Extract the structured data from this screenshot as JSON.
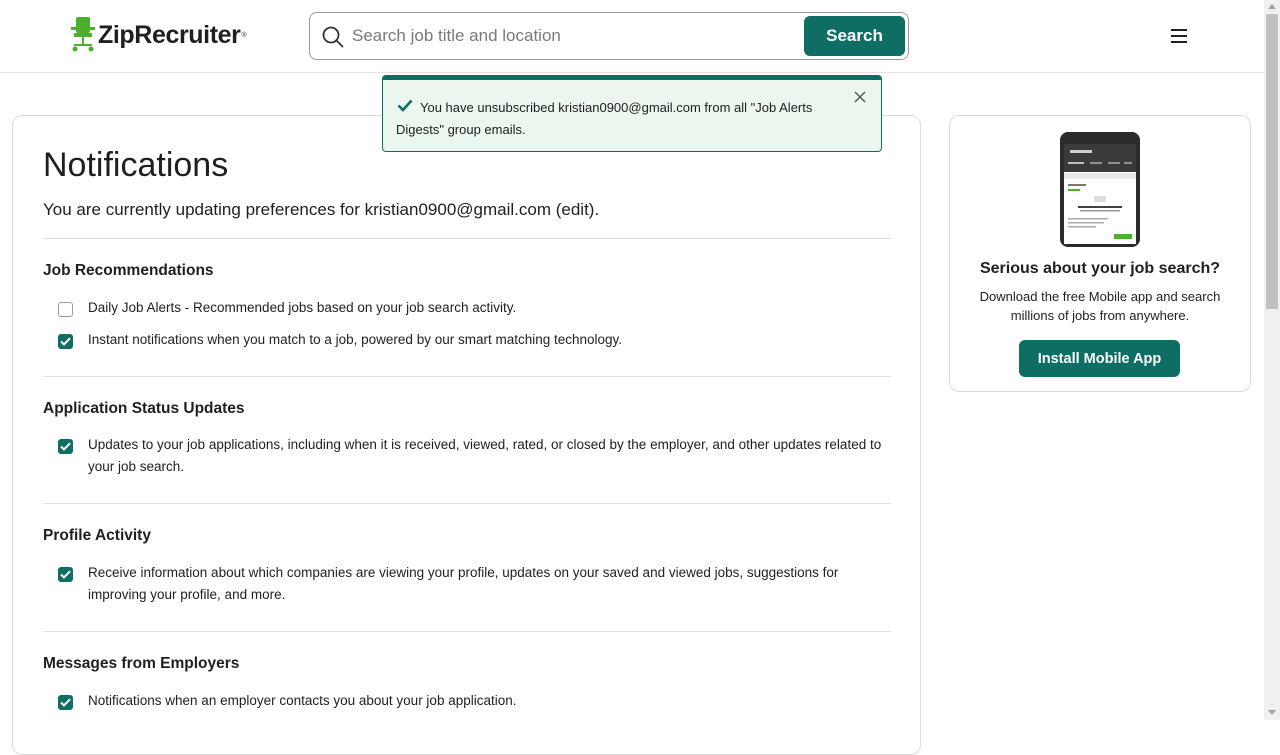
{
  "header": {
    "logo_text": "ZipRecruiter",
    "logo_tm": "®",
    "logo_icon": "office-chair-icon",
    "search_placeholder": "Search job title and location",
    "search_value": "",
    "search_button": "Search",
    "menu_icon": "hamburger-menu-icon"
  },
  "toast": {
    "message": "You have unsubscribed kristian0900@gmail.com from all \"Job Alerts Digests\" group emails.",
    "check_icon": "checkmark-icon",
    "close_icon": "close-icon"
  },
  "main": {
    "title": "Notifications",
    "preferences_line": "You are currently updating preferences for kristian0900@gmail.com (edit).",
    "sections": [
      {
        "title": "Job Recommendations",
        "options": [
          {
            "label": "Daily Job Alerts - Recommended jobs based on your job search activity.",
            "checked": false
          },
          {
            "label": "Instant notifications when you match to a job, powered by our smart matching technology.",
            "checked": true
          }
        ]
      },
      {
        "title": "Application Status Updates",
        "options": [
          {
            "label": "Updates to your job applications, including when it is received, viewed, rated, or closed by the employer, and other updates related to your job search.",
            "checked": true
          }
        ]
      },
      {
        "title": "Profile Activity",
        "options": [
          {
            "label": "Receive information about which companies are viewing your profile, updates on your saved and viewed jobs, suggestions for improving your profile, and more.",
            "checked": true
          }
        ]
      },
      {
        "title": "Messages from Employers",
        "options": [
          {
            "label": "Notifications when an employer contacts you about your job application.",
            "checked": true
          }
        ]
      }
    ]
  },
  "sidebar": {
    "title": "Serious about your job search?",
    "text": "Download the free Mobile app and search millions of jobs from anywhere.",
    "button": "Install Mobile App",
    "phone_image": "mobile-app-screenshot"
  },
  "colors": {
    "brand": "#0f6e63",
    "toast_bg": "#eaf6ee"
  }
}
